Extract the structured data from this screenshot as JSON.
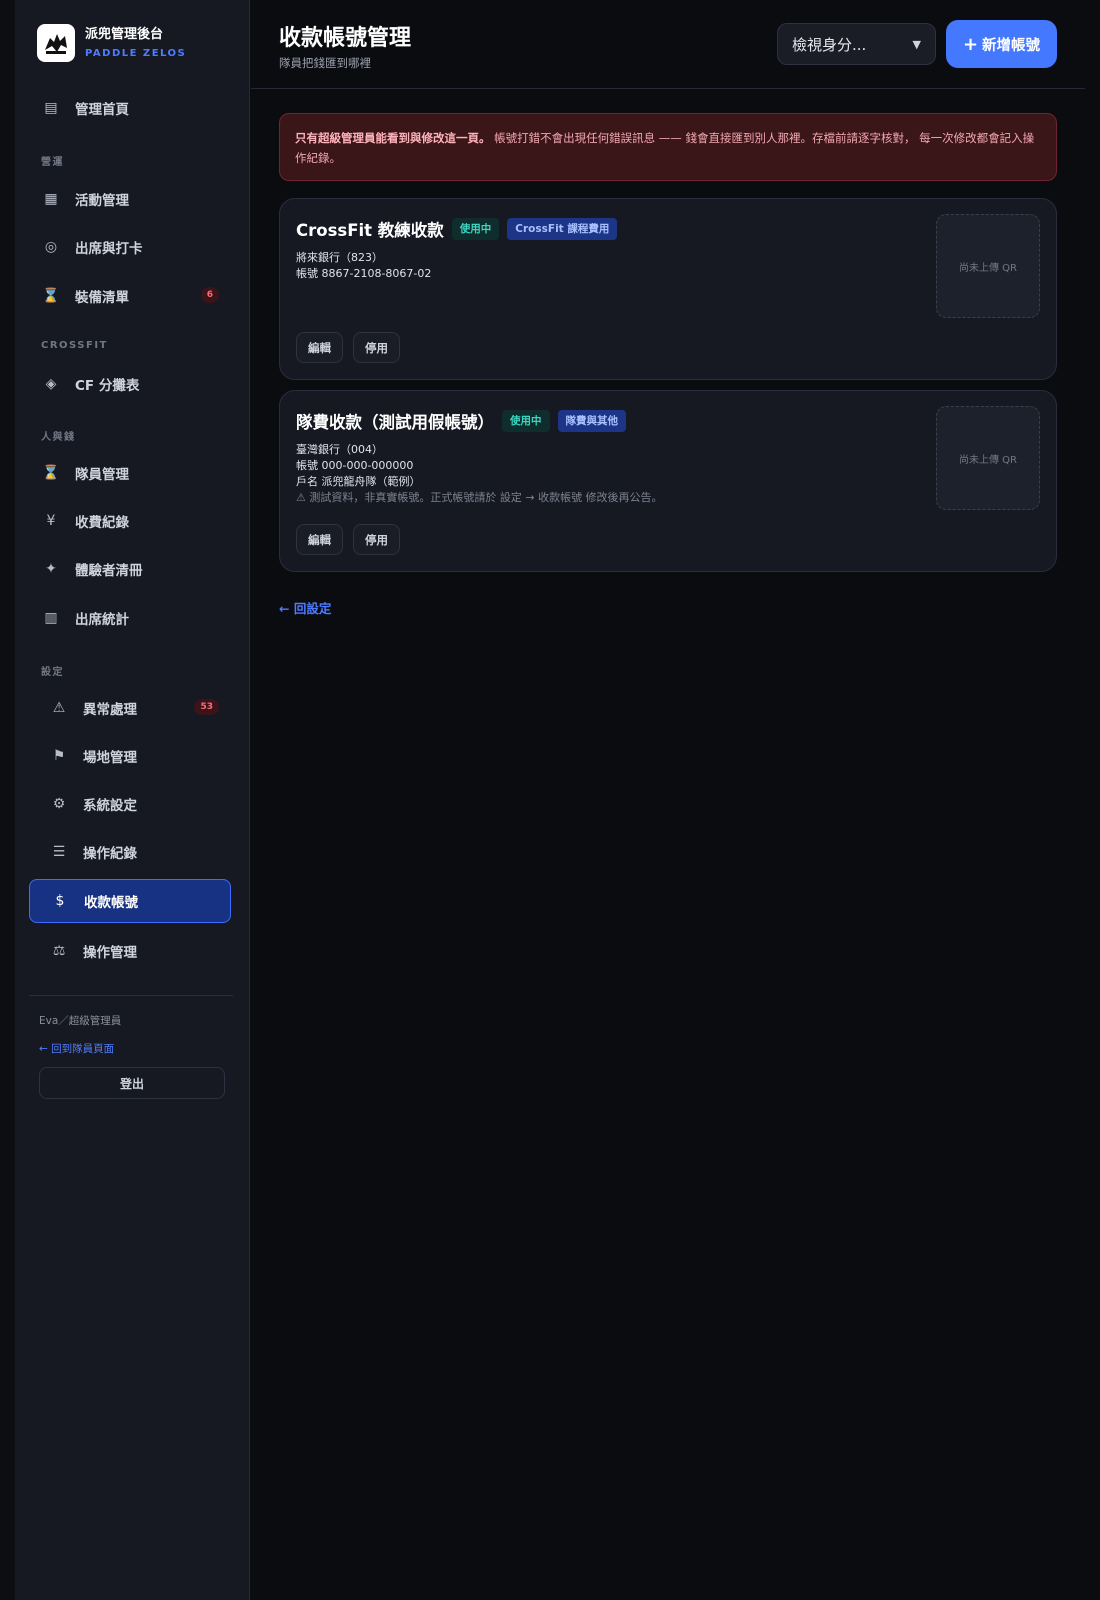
{
  "brand": {
    "title": "派兜管理後台",
    "subtitle": "PADDLE ZELOS"
  },
  "sidebar": {
    "home": {
      "icon": "list-icon",
      "label": "管理首頁"
    },
    "sections": [
      "營運",
      "CROSSFIT",
      "人與錢",
      "設定"
    ],
    "items": [
      {
        "icon": "grid-icon",
        "label": "活動管理"
      },
      {
        "icon": "target-icon",
        "label": "出席與打卡"
      },
      {
        "icon": "hourglass-icon",
        "label": "裝備清單",
        "badge": "6"
      },
      {
        "icon": "diamond-icon",
        "label": "CF 分攤表"
      },
      {
        "icon": "hourglass-icon",
        "label": "隊員管理"
      },
      {
        "icon": "yen-icon",
        "label": "收費紀錄"
      },
      {
        "icon": "sparkle-icon",
        "label": "體驗者清冊"
      },
      {
        "icon": "columns-icon",
        "label": "出席統計"
      },
      {
        "icon": "warning-icon",
        "label": "異常處理",
        "badge": "53"
      },
      {
        "icon": "flag-icon",
        "label": "場地管理"
      },
      {
        "icon": "gear-icon",
        "label": "系統設定"
      },
      {
        "icon": "lines-icon",
        "label": "操作紀錄"
      },
      {
        "icon": "dollar-icon",
        "label": "收款帳號",
        "active": true
      },
      {
        "icon": "scale-icon",
        "label": "操作管理"
      }
    ],
    "user": "Eva／超級管理員",
    "back_member": "← 回到隊員頁面",
    "logout": "登出"
  },
  "header": {
    "title": "收款帳號管理",
    "subtitle": "隊員把錢匯到哪裡",
    "role_select": "檢視身分...",
    "add_button": "新增帳號"
  },
  "alert": {
    "bold": "只有超級管理員能看到與修改這一頁。",
    "text": "帳號打錯不會出現任何錯誤訊息 —— 錢會直接匯到別人那裡。存檔前請逐字核對， 每一次修改都會記入操作紀錄。"
  },
  "accounts": [
    {
      "name": "CrossFit 教練收款",
      "status": "使用中",
      "category": "CrossFit 課程費用",
      "bank": "將來銀行（823）",
      "account_label": "帳號",
      "account": "8867-2108-8067-02",
      "qr": "尚未上傳 QR",
      "edit": "編輯",
      "disable": "停用"
    },
    {
      "name": "隊費收款（測試用假帳號）",
      "status": "使用中",
      "category": "隊費與其他",
      "bank": "臺灣銀行（004）",
      "account_label": "帳號",
      "account": "000-000-000000",
      "holder": "戶名 派兜龍舟隊（範例）",
      "note": "⚠ 測試資料，非真實帳號。正式帳號請於 設定 → 收款帳號 修改後再公告。",
      "qr": "尚未上傳 QR",
      "edit": "編輯",
      "disable": "停用"
    }
  ],
  "back_settings": "← 回設定"
}
